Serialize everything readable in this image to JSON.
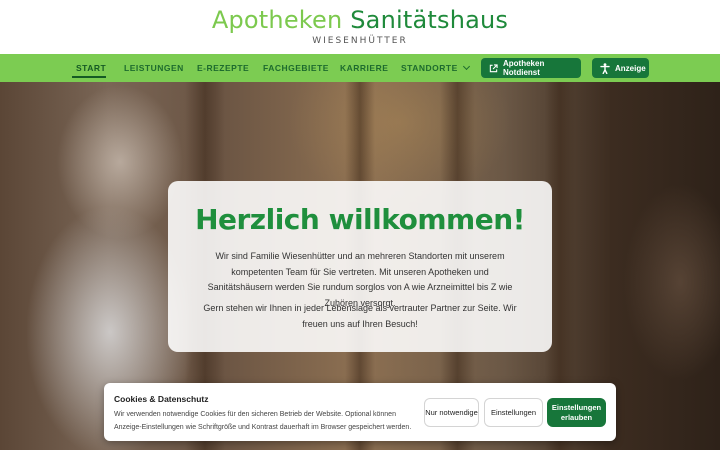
{
  "header": {
    "brand_light": "Apotheken",
    "brand_dark": "Sanitätshaus",
    "brand_sub": "WIESENHÜTTER"
  },
  "nav": {
    "items": [
      {
        "label": "START"
      },
      {
        "label": "LEISTUNGEN"
      },
      {
        "label": "E-REZEPTE"
      },
      {
        "label": "FACHGEBIETE"
      },
      {
        "label": "KARRIERE"
      },
      {
        "label": "STANDORTE"
      }
    ],
    "notdienst_label": "Apotheken Notdienst",
    "anzeige_label": "Anzeige"
  },
  "hero": {
    "title": "Herzlich willkommen!",
    "paragraph1": "Wir sind Familie Wiesenhütter und an mehreren Standorten mit unserem kompetenten Team für Sie vertreten. Mit unseren Apotheken und Sanitätshäusern werden Sie rundum sorglos von A wie Arzneimittel bis Z wie Zuhören versorgt.",
    "paragraph2": "Gern stehen wir Ihnen in jeder Lebenslage als vertrauter Partner zur Seite. Wir freuen uns auf Ihren Besuch!"
  },
  "cookie": {
    "title": "Cookies & Datenschutz",
    "text": "Wir verwenden notwendige Cookies für den sicheren Betrieb der Website. Optional können Anzeige-Einstellungen wie Schriftgröße und Kontrast dauerhaft im Browser gespeichert werden.",
    "btn_necessary": "Nur notwendige",
    "btn_settings": "Einstellungen",
    "btn_allow": "Einstellungen erlauben"
  },
  "colors": {
    "brand_light": "#7cc94e",
    "brand_dark": "#1f8a3b",
    "nav_bg": "#7ccc52",
    "button_green": "#17763a"
  },
  "icons": {
    "notdienst": "external-link-icon",
    "anzeige": "accessibility-icon",
    "standorte": "chevron-down-icon"
  }
}
